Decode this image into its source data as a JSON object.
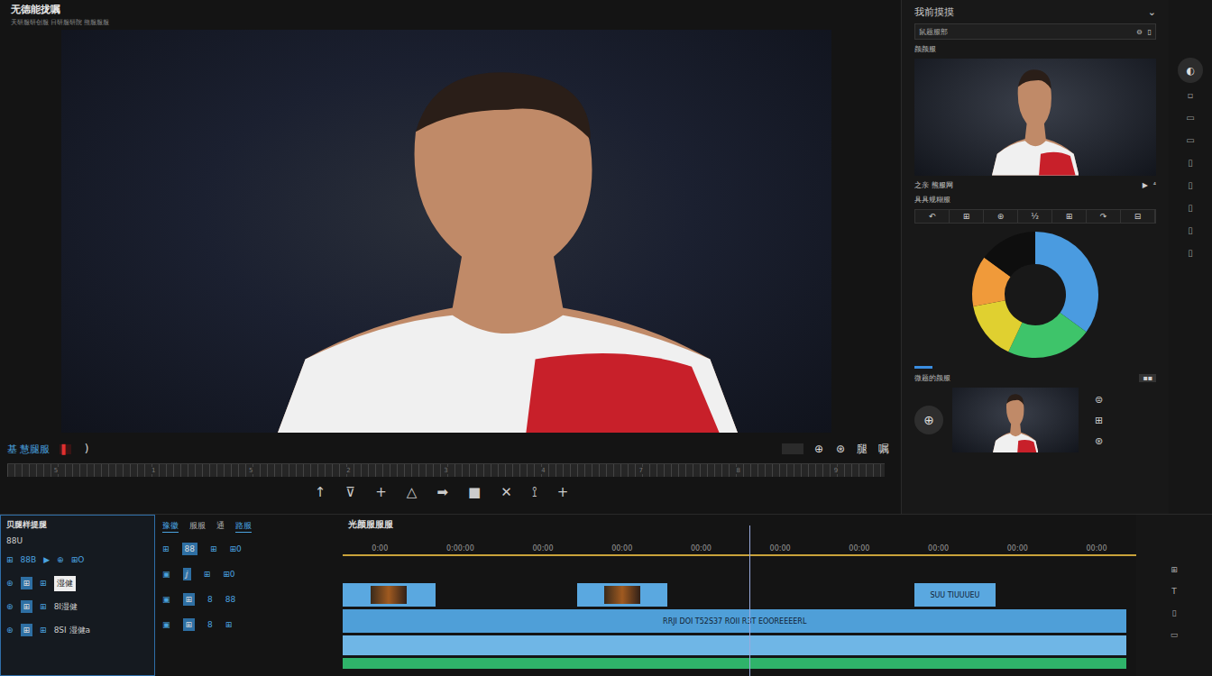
{
  "window": {
    "title": "无德能拢嘱",
    "subtitle": "天研服研创服  日研服研院 熊服服服"
  },
  "transport": {
    "label": "基 慧腿服",
    "record": "▌",
    "bracket": ")",
    "icons": [
      "⊕",
      "⊛",
      "腿",
      "嘱"
    ]
  },
  "ruler": [
    "5",
    "1",
    "5",
    "2",
    "3",
    "4",
    "7",
    "8",
    "9"
  ],
  "tools": [
    "↑",
    "⊽",
    "+",
    "△",
    "➡",
    "■",
    "✕",
    "⟟",
    "+"
  ],
  "right_panel": {
    "title": "我前摸摸",
    "chevron": "⌄",
    "search": {
      "value": "鼠题服部",
      "icons": [
        "⊖",
        "▯"
      ]
    },
    "preview_label": "颜颜服",
    "caption": "之亲 熊服网",
    "caption_icons": [
      "▶",
      "⁴"
    ],
    "scopes_label": "具具规糊服",
    "scope_tools": [
      "↶",
      "⊞",
      "⊛",
      "½",
      "⊞",
      "↷",
      "⊟"
    ],
    "donut": {
      "values": [
        35,
        22,
        15,
        13,
        15
      ],
      "colors": [
        "#4a9be0",
        "#3ec46a",
        "#e0d030",
        "#f09a3a",
        "#0e0e0e"
      ]
    },
    "source_label": "微题的颜服",
    "source_badge": "▪▪",
    "source_button": "⊕",
    "source_icons": [
      "⊜",
      "⊞",
      "⊛"
    ]
  },
  "strip": {
    "icons": [
      "◐",
      "▫",
      "▭",
      "▭",
      "▯",
      "▯",
      "▯",
      "▯",
      "▯"
    ]
  },
  "media": {
    "title": "贝腿样提腿",
    "subtitle": "88U",
    "rows": [
      {
        "icons": [
          "⊞",
          "88B",
          "▶",
          "⊕",
          "⊞O"
        ]
      },
      {
        "icons": [
          "⊛",
          "⊞",
          "⊞"
        ],
        "label": "湿健",
        "highlight": true
      },
      {
        "icons": [
          "⊛",
          "⊞",
          "⊞"
        ],
        "label": "8I湿健"
      },
      {
        "icons": [
          "⊛",
          "⊞",
          "⊞"
        ],
        "label": "8SI 湿健a"
      }
    ]
  },
  "mid": {
    "tabs": [
      {
        "label": "豫徽",
        "selected": true
      },
      {
        "label": "服服",
        "selected": false
      },
      {
        "label": "通",
        "selected": false
      },
      {
        "label": "路服",
        "selected": true
      }
    ],
    "rows": [
      [
        "⊞",
        "88",
        "⊞",
        "⊞0"
      ],
      [
        "▣",
        "ⅉ",
        "⊞",
        "⊞0"
      ],
      [
        "▣",
        "⊞",
        "8",
        "88"
      ],
      [
        "▣",
        "⊞",
        "8",
        "⊞"
      ]
    ]
  },
  "timeline": {
    "title": "光颜服服服",
    "ticks": [
      "0:00",
      "0:00:00",
      "00:00",
      "00:00",
      "00:00",
      "00:00",
      "00:00",
      "00:00",
      "00:00",
      "00:00"
    ],
    "playhead": 0.512,
    "tracks": [
      {
        "color": "#5aa8e0",
        "clips": [
          {
            "label": "",
            "thumb": true,
            "start": 0,
            "end": 0.117
          },
          {
            "label": "",
            "thumb": true,
            "start": 0.295,
            "end": 0.409
          },
          {
            "label": "SUU  TIUUUEU",
            "thumb": false,
            "start": 0.72,
            "end": 0.823
          }
        ]
      },
      {
        "color": "#4f9fd8",
        "clips": [
          {
            "label": "RRJI      DOI   T52S37   ROII                    R3T   EOOREEEERL",
            "thumb": false,
            "start": 0,
            "end": 0.988
          }
        ]
      },
      {
        "color": "#6fb6e6",
        "clips": [
          {
            "label": "",
            "thumb": false,
            "start": 0,
            "end": 0.988
          }
        ]
      },
      {
        "color": "#2fb36a",
        "clips": [
          {
            "label": "",
            "thumb": false,
            "start": 0,
            "end": 0.988
          }
        ]
      }
    ]
  },
  "side": {
    "icons": [
      "⊞",
      "T",
      "▯",
      "▭"
    ]
  }
}
